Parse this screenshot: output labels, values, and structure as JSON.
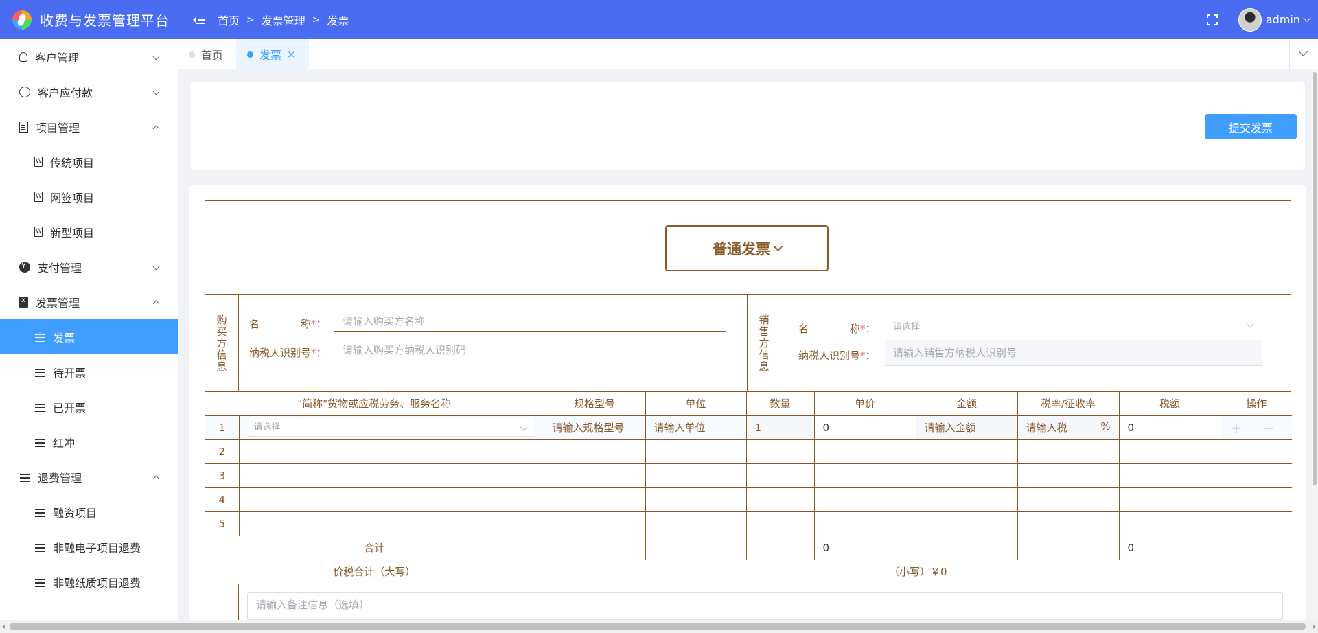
{
  "header": {
    "app_title": "收费与发票管理平台",
    "breadcrumb": [
      "首页",
      "发票管理",
      "发票"
    ],
    "breadcrumb_sep": ">",
    "user_name": "admin"
  },
  "sidebar": {
    "items": [
      {
        "label": "客户管理",
        "icon": "user-icon",
        "expanded": false
      },
      {
        "label": "客户应付款",
        "icon": "payable-icon",
        "expanded": false
      },
      {
        "label": "项目管理",
        "icon": "project-icon",
        "expanded": true
      },
      {
        "label": "传统项目",
        "icon": "file-icon"
      },
      {
        "label": "网签项目",
        "icon": "file-icon"
      },
      {
        "label": "新型项目",
        "icon": "file-icon"
      },
      {
        "label": "支付管理",
        "icon": "payment-icon",
        "expanded": false
      },
      {
        "label": "发票管理",
        "icon": "invoice-icon",
        "expanded": true
      },
      {
        "label": "发票",
        "icon": "list-icon",
        "active": true
      },
      {
        "label": "待开票",
        "icon": "list-icon"
      },
      {
        "label": "已开票",
        "icon": "list-icon"
      },
      {
        "label": "红冲",
        "icon": "list-icon"
      },
      {
        "label": "退费管理",
        "icon": "list-icon",
        "expanded": true
      },
      {
        "label": "融资项目",
        "icon": "list-icon"
      },
      {
        "label": "非融电子项目退费",
        "icon": "list-icon"
      },
      {
        "label": "非融纸质项目退费",
        "icon": "list-icon"
      }
    ]
  },
  "tabs": [
    {
      "label": "首页",
      "active": false
    },
    {
      "label": "发票",
      "active": true,
      "close": "×"
    }
  ],
  "toolbar": {
    "submit_label": "提交发票"
  },
  "invoice": {
    "type_label": "普通发票",
    "buyer": {
      "section_label": "购买方信息",
      "name_label": "名　　　　称",
      "taxid_label": "纳税人识别号",
      "required_mark": "*",
      "colon": "：",
      "name_placeholder": "请输入购买方名称",
      "taxid_placeholder": "请输入购买方纳税人识别码"
    },
    "seller": {
      "section_label": "销售方信息",
      "name_label": "名　　　　称",
      "taxid_label": "纳税人识别号",
      "required_mark": "*",
      "colon": "：",
      "name_placeholder": "请选择",
      "taxid_placeholder": "请输入销售方纳税人识别号"
    },
    "columns": [
      "\"简称\"货物或应税劳务、服务名称",
      "规格型号",
      "单位",
      "数量",
      "单价",
      "金额",
      "税率/征收率",
      "税额",
      "操作"
    ],
    "edit_row": {
      "index": "1",
      "name_placeholder": "请选择",
      "spec_placeholder": "请输入规格型号",
      "unit_placeholder": "请输入单位",
      "quantity": "1",
      "price": "0",
      "amount_placeholder": "请输入金额",
      "rate_placeholder": "请输入税",
      "rate_unit": "%",
      "tax": "0",
      "ops": "+ −"
    },
    "empty_rows": [
      "2",
      "3",
      "4",
      "5"
    ],
    "total_label": "合计",
    "total_price": "0",
    "total_tax": "0",
    "sum_caps_label": "价税合计（大写）",
    "sum_small": "（小写）￥0",
    "remark_placeholder": "请输入备注信息（选填）"
  }
}
